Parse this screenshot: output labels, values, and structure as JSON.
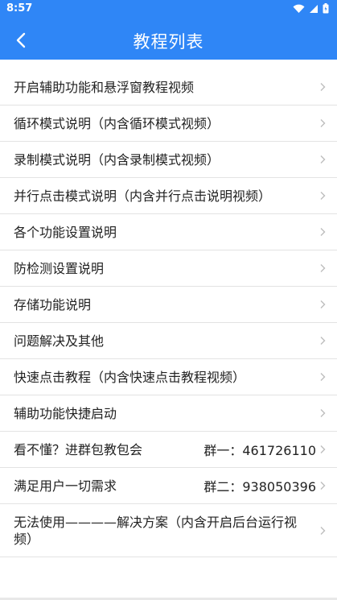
{
  "status": {
    "time": "8:57"
  },
  "header": {
    "title": "教程列表"
  },
  "items": [
    {
      "label": "开启辅助功能和悬浮窗教程视频",
      "extra": ""
    },
    {
      "label": "循环模式说明（内含循环模式视频）",
      "extra": ""
    },
    {
      "label": "录制模式说明（内含录制模式视频）",
      "extra": ""
    },
    {
      "label": "并行点击模式说明（内含并行点击说明视频）",
      "extra": ""
    },
    {
      "label": "各个功能设置说明",
      "extra": ""
    },
    {
      "label": "防检测设置说明",
      "extra": ""
    },
    {
      "label": "存储功能说明",
      "extra": ""
    },
    {
      "label": "问题解决及其他",
      "extra": ""
    },
    {
      "label": "快速点击教程（内含快速点击教程视频）",
      "extra": ""
    },
    {
      "label": "辅助功能快捷启动",
      "extra": ""
    },
    {
      "label": "看不懂？进群包教包会",
      "extra": "群一：461726110"
    },
    {
      "label": "满足用户一切需求",
      "extra": "群二：938050396"
    },
    {
      "label": "无法使用————解决方案（内含开启后台运行视频）",
      "extra": ""
    }
  ],
  "colors": {
    "header": "#2f86f6",
    "divider": "#e3e3e3",
    "chevron": "#bdbdbd"
  }
}
